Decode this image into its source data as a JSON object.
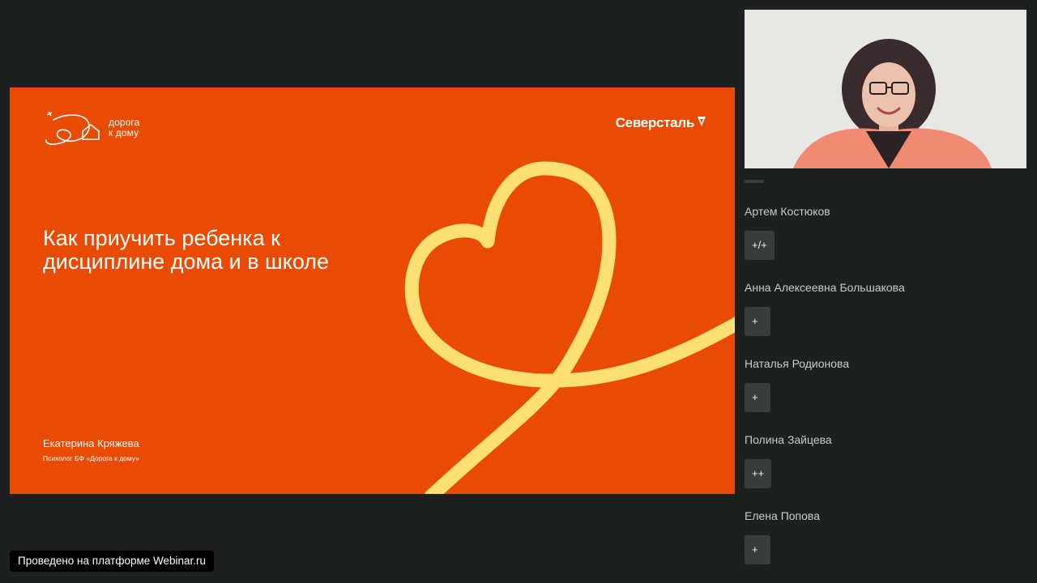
{
  "slide": {
    "logo_line1": "дорога",
    "logo_line2": "к дому",
    "brand": "Северсталь",
    "title": "Как приучить ребенка к дисциплине дома и в школе",
    "author": "Екатерина Кряжева",
    "author_role": "Психолог БФ «Дорога к дому»",
    "bg_color": "#e94b05",
    "heart_color": "#fde074"
  },
  "feed": [
    {
      "name": "Артем Костюков",
      "text": "+/+"
    },
    {
      "name": "Анна Алексеевна Большакова",
      "text": "+"
    },
    {
      "name": "Наталья Родионова",
      "text": "+"
    },
    {
      "name": "Полина Зайцева",
      "text": "++"
    },
    {
      "name": "Елена Попова",
      "text": "+"
    }
  ],
  "platform_badge": "Проведено на платформе Webinar.ru"
}
